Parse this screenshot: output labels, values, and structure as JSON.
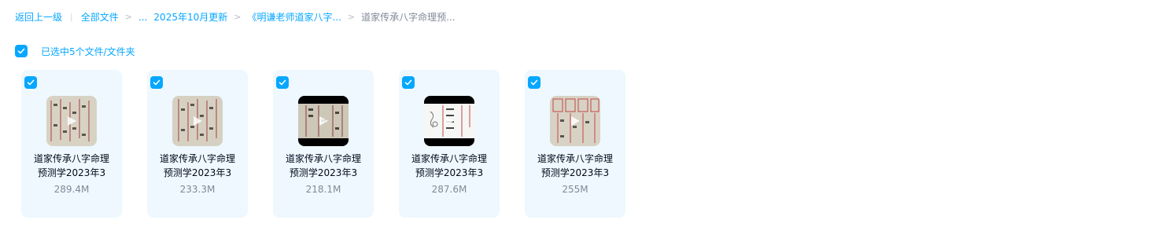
{
  "breadcrumb": {
    "back": "返回上一级",
    "all_files": "全部文件",
    "ellipsis": "...",
    "folder1": "2025年10月更新",
    "folder2": "《明谦老师道家八字...",
    "current": "道家传承八字命理预..."
  },
  "selection": {
    "label": "已选中5个文件/文件夹"
  },
  "colors": {
    "accent": "#06a7ff",
    "card_bg": "#eef8fe",
    "muted": "#818999"
  },
  "files": [
    {
      "name_line1": "道家传承八字命理",
      "name_line2": "预测学2023年3",
      "size": "289.4M",
      "thumb": "video-beige"
    },
    {
      "name_line1": "道家传承八字命理",
      "name_line2": "预测学2023年3",
      "size": "233.3M",
      "thumb": "video-beige"
    },
    {
      "name_line1": "道家传承八字命理",
      "name_line2": "预测学2023年3",
      "size": "218.1M",
      "thumb": "video-letterbox"
    },
    {
      "name_line1": "道家传承八字命理",
      "name_line2": "预测学2023年3",
      "size": "287.6M",
      "thumb": "video-letterbox-white"
    },
    {
      "name_line1": "道家传承八字命理",
      "name_line2": "预测学2023年3",
      "size": "255M",
      "thumb": "video-beige-red"
    }
  ]
}
